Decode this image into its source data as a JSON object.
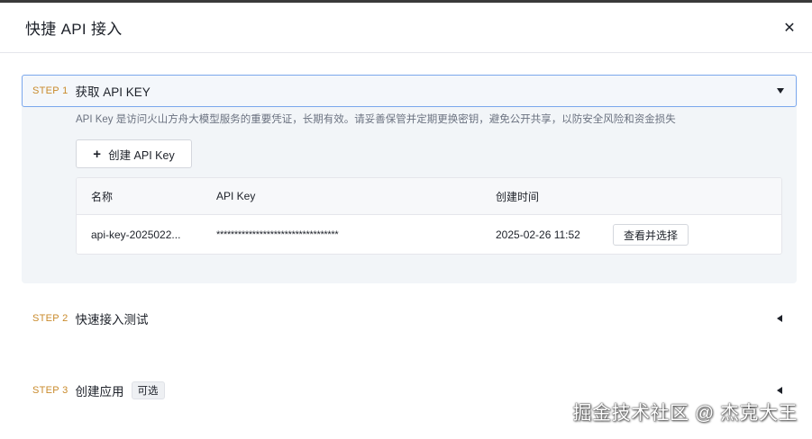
{
  "modal": {
    "title": "快捷 API 接入",
    "close_icon": "✕"
  },
  "step1": {
    "tag": "STEP 1",
    "title": "获取 API KEY",
    "description": "API Key 是访问火山方舟大模型服务的重要凭证，长期有效。请妥善保管并定期更换密钥，避免公开共享，以防安全风险和资金损失",
    "create_button": "创建 API Key",
    "table": {
      "headers": [
        "名称",
        "API Key",
        "创建时间"
      ],
      "rows": [
        {
          "name": "api-key-2025022...",
          "key": "**********************************",
          "created": "2025-02-26 11:52",
          "action": "查看并选择"
        }
      ]
    }
  },
  "step2": {
    "tag": "STEP 2",
    "title": "快速接入测试"
  },
  "step3": {
    "tag": "STEP 3",
    "title": "创建应用",
    "badge": "可选"
  },
  "watermark": "掘金技术社区 @ 杰克大王",
  "colors": {
    "step_tag": "#c98a2b",
    "active_border": "#7aa7ec",
    "panel_bg": "#f2f5f8"
  },
  "icons": {
    "close": "close-icon",
    "plus": "plus-icon",
    "expanded": "caret-down-icon",
    "collapsed": "caret-left-icon"
  }
}
